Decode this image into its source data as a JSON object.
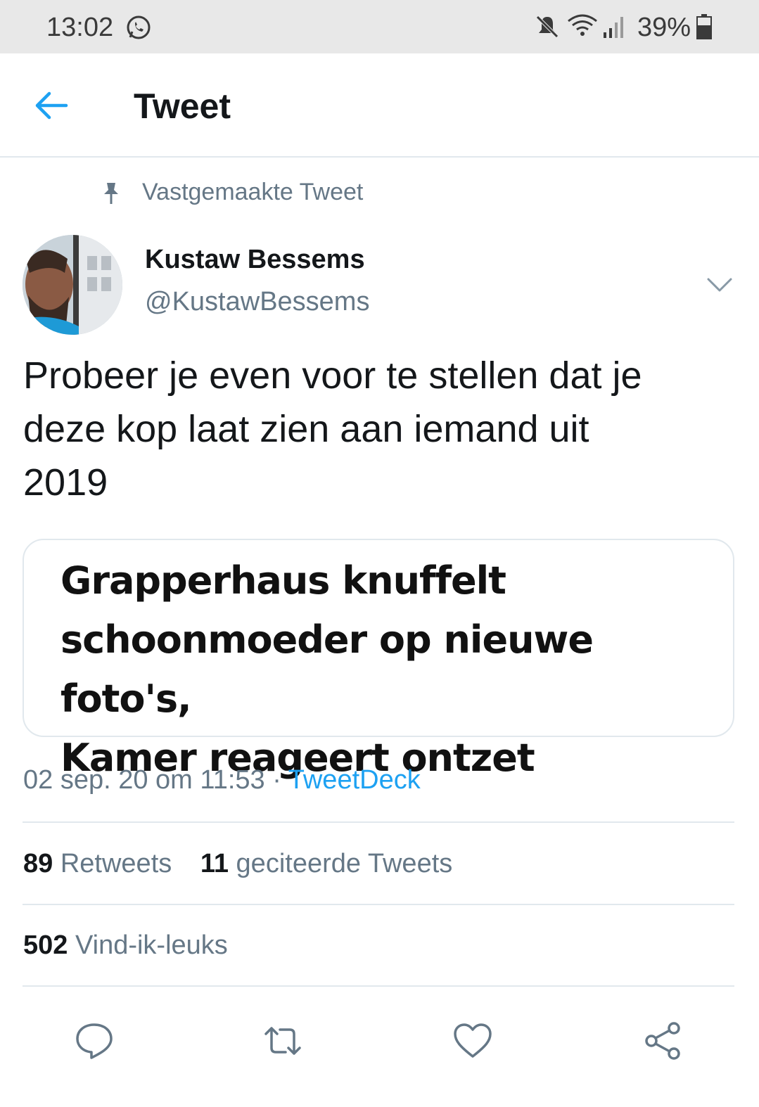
{
  "status_bar": {
    "time": "13:02",
    "battery": "39%",
    "icons": [
      "whatsapp-icon",
      "mute-icon",
      "wifi-icon",
      "signal-icon",
      "battery-icon"
    ]
  },
  "header": {
    "title": "Tweet",
    "back_icon": "arrow-left-icon"
  },
  "tweet": {
    "pinned_label": "Vastgemaakte Tweet",
    "author_name": "Kustaw Bessems",
    "author_handle": "@KustawBessems",
    "text_lines": [
      "Probeer je even voor te stellen dat je",
      "deze kop laat zien aan iemand uit",
      "2019"
    ],
    "card_headline_lines": [
      "Grapperhaus knuffelt",
      "schoonmoeder op nieuwe foto's,",
      "Kamer reageert ontzet"
    ],
    "date": "02 sep. 20 om 11:53",
    "separator": "·",
    "source": "TweetDeck",
    "retweets_count": "89",
    "retweets_label": "Retweets",
    "quotes_count": "11",
    "quotes_label": "geciteerde Tweets",
    "likes_count": "502",
    "likes_label": "Vind-ik-leuks"
  },
  "colors": {
    "accent": "#1da1f2",
    "secondary_text": "#657786",
    "divider": "#e1e8ed"
  }
}
